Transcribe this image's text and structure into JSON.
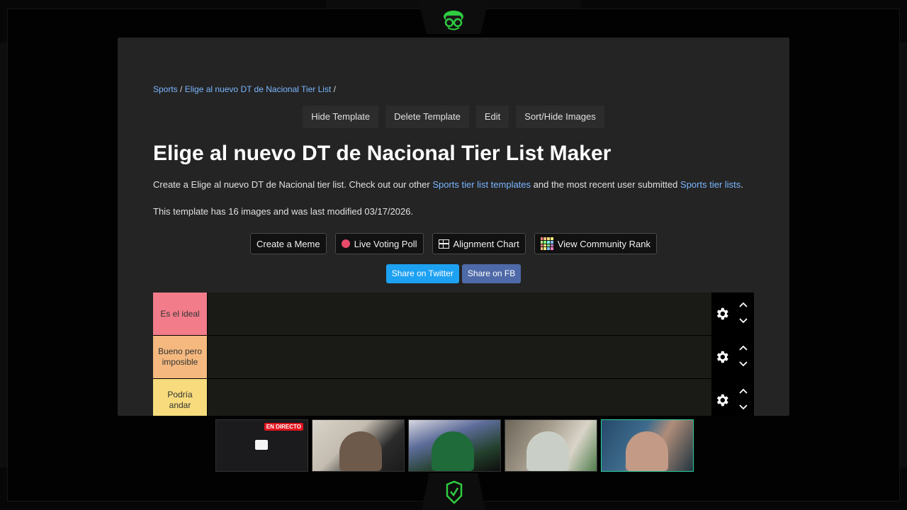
{
  "breadcrumb": {
    "root": "Sports",
    "sep1": "/",
    "current": "Elige al nuevo DT de Nacional Tier List",
    "sep2": "/"
  },
  "template_actions": {
    "hide": "Hide Template",
    "delete": "Delete Template",
    "edit": "Edit",
    "sort": "Sort/Hide Images"
  },
  "title": "Elige al nuevo DT de Nacional Tier List Maker",
  "description": {
    "part1": "Create a Elige al nuevo DT de Nacional tier list. Check out our other ",
    "link1": "Sports tier list templates",
    "part2": " and the most recent user submitted ",
    "link2": "Sports tier lists",
    "part3": "."
  },
  "info": "This template has 16 images and was last modified 03/17/2026.",
  "tools": {
    "meme": "Create a Meme",
    "poll": "Live Voting Poll",
    "alignment": "Alignment Chart",
    "community": "View Community Rank"
  },
  "share": {
    "twitter": "Share on Twitter",
    "fb": "Share on FB"
  },
  "tiers": [
    {
      "label": "Es el ideal",
      "color": "#f27c8a"
    },
    {
      "label": "Bueno pero imposible",
      "color": "#f5b97f"
    },
    {
      "label": "Podría andar",
      "color": "#f7db7d"
    }
  ],
  "stream": {
    "live_badge": "EN DIRECTO"
  },
  "colors": {
    "accent_link": "#7ab6ff",
    "twitter": "#1da1f2",
    "facebook": "#4f6aa8",
    "logo_green": "#2ecc40"
  }
}
